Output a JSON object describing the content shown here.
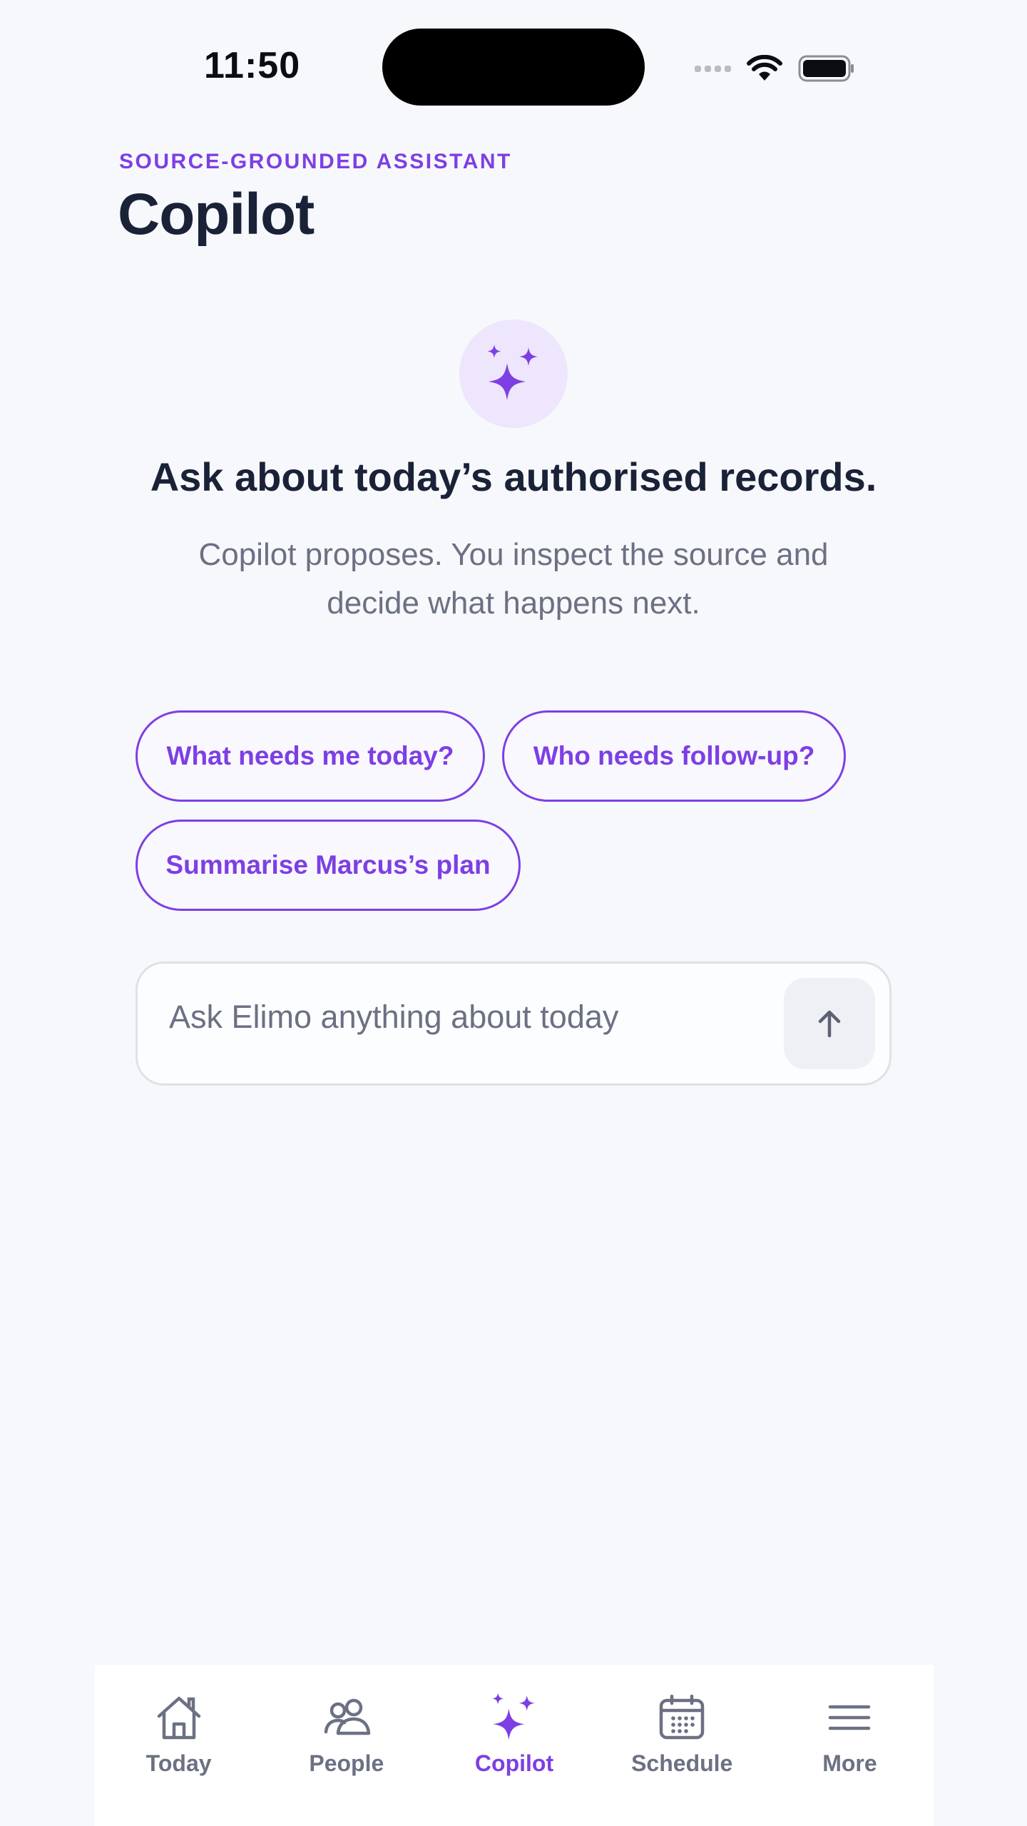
{
  "status_bar": {
    "time": "11:50"
  },
  "header": {
    "eyebrow": "SOURCE-GROUNDED ASSISTANT",
    "title": "Copilot"
  },
  "hero": {
    "icon": "sparkles-icon",
    "heading": "Ask about today’s authorised records.",
    "subtitle": "Copilot proposes. You inspect the source and decide what happens next."
  },
  "suggestions": [
    "What needs me today?",
    "Who needs follow-up?",
    "Summarise Marcus’s plan"
  ],
  "ask": {
    "placeholder": "Ask Elimo anything about today",
    "value": "",
    "send_icon": "arrow-up-icon"
  },
  "tabbar": {
    "active": "Copilot",
    "items": [
      {
        "label": "Today",
        "icon": "home-icon"
      },
      {
        "label": "People",
        "icon": "people-icon"
      },
      {
        "label": "Copilot",
        "icon": "sparkles-icon"
      },
      {
        "label": "Schedule",
        "icon": "calendar-icon"
      },
      {
        "label": "More",
        "icon": "menu-icon"
      }
    ]
  },
  "colors": {
    "accent": "#7d3fe4",
    "background": "#f7f8fb",
    "text_primary": "#1a2238",
    "text_secondary": "#6b7183",
    "badge_bg": "#ede6fc"
  }
}
